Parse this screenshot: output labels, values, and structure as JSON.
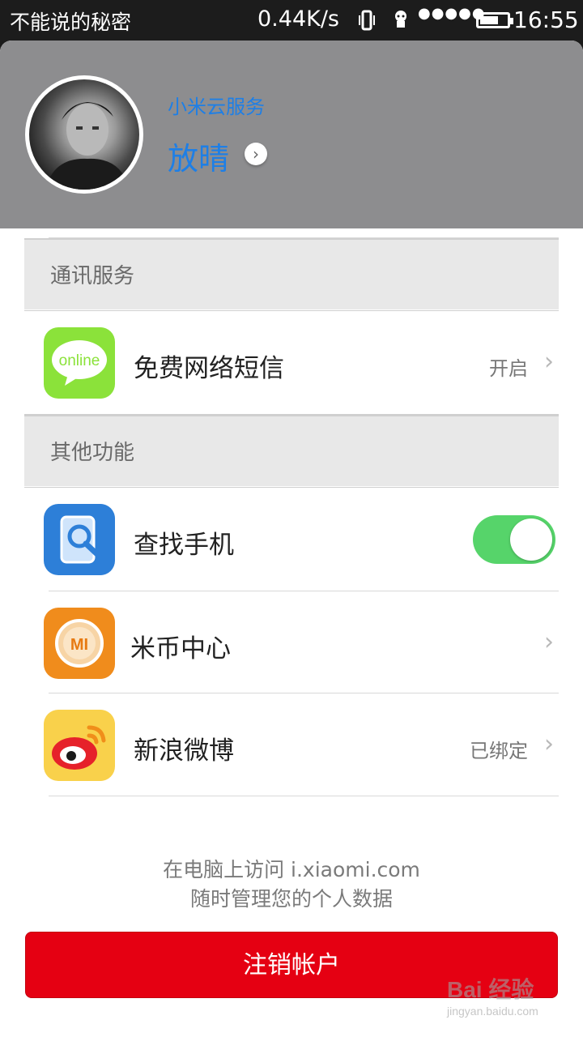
{
  "statusbar": {
    "carrier": "不能说的秘密",
    "speed": "0.44K/s",
    "signal": "●●●●●",
    "time": "16:55"
  },
  "header": {
    "service_label": "小米云服务",
    "user_name": "放晴"
  },
  "sections": {
    "comm": "通讯服务",
    "other": "其他功能"
  },
  "rows": {
    "sms": {
      "label": "免费网络短信",
      "status": "开启",
      "icon_text": "online"
    },
    "find_phone": {
      "label": "查找手机",
      "toggle_on": true
    },
    "mi_coin": {
      "label": "米币中心",
      "icon_text": "MI"
    },
    "weibo": {
      "label": "新浪微博",
      "status": "已绑定"
    }
  },
  "footer": {
    "line1": "在电脑上访问 i.xiaomi.com",
    "line2": "随时管理您的个人数据",
    "logout_label": "注销帐户"
  },
  "watermark": {
    "logo": "Bai 经验",
    "url": "jingyan.baidu.com"
  },
  "colors": {
    "accent": "#1e7fe6",
    "toggle": "#56d46a",
    "logout": "#e50012"
  }
}
